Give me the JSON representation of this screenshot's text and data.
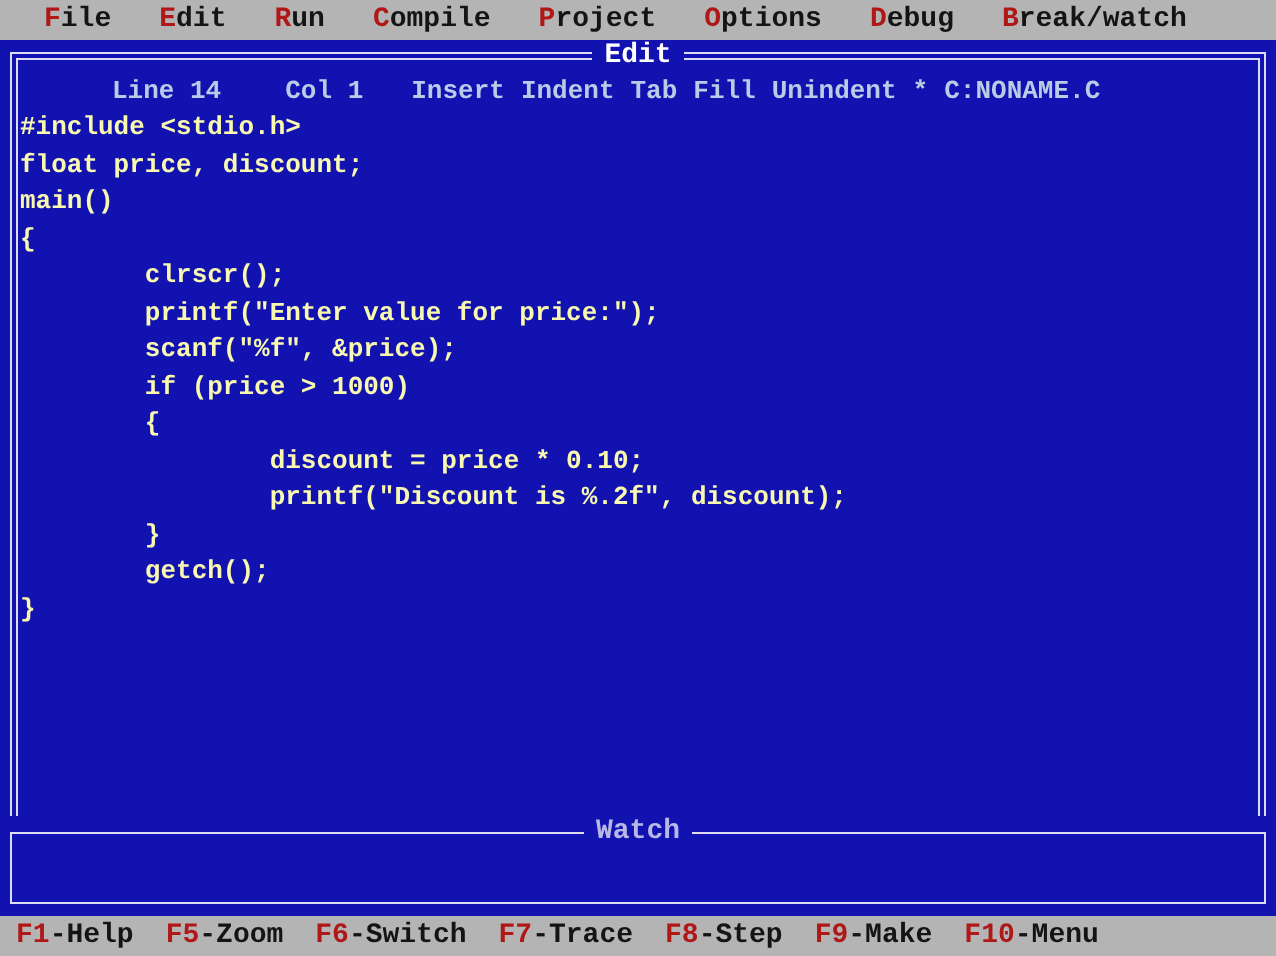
{
  "menu": [
    {
      "key": "F",
      "rest": "ile"
    },
    {
      "key": "E",
      "rest": "dit"
    },
    {
      "key": "R",
      "rest": "un"
    },
    {
      "key": "C",
      "rest": "ompile"
    },
    {
      "key": "P",
      "rest": "roject"
    },
    {
      "key": "O",
      "rest": "ptions"
    },
    {
      "key": "D",
      "rest": "ebug"
    },
    {
      "key": "B",
      "rest": "reak/watch"
    }
  ],
  "edit_window": {
    "title": "Edit",
    "active": true,
    "status": {
      "line": "Line 14",
      "col": "Col 1",
      "modes": [
        "Insert",
        "Indent",
        "Tab",
        "Fill",
        "Unindent"
      ],
      "modified": "*",
      "file": "C:NONAME.C"
    },
    "code": [
      "#include <stdio.h>",
      "float price, discount;",
      "main()",
      "{",
      "        clrscr();",
      "        printf(\"Enter value for price:\");",
      "        scanf(\"%f\", &price);",
      "        if (price > 1000)",
      "        {",
      "                discount = price * 0.10;",
      "                printf(\"Discount is %.2f\", discount);",
      "        }",
      "        getch();",
      "}"
    ]
  },
  "watch_window": {
    "title": "Watch",
    "active": false
  },
  "function_keys": [
    {
      "key": "F1",
      "label": "-Help"
    },
    {
      "key": "F5",
      "label": "-Zoom"
    },
    {
      "key": "F6",
      "label": "-Switch"
    },
    {
      "key": "F7",
      "label": "-Trace"
    },
    {
      "key": "F8",
      "label": "-Step"
    },
    {
      "key": "F9",
      "label": "-Make"
    },
    {
      "key": "F10",
      "label": "-Menu"
    }
  ]
}
